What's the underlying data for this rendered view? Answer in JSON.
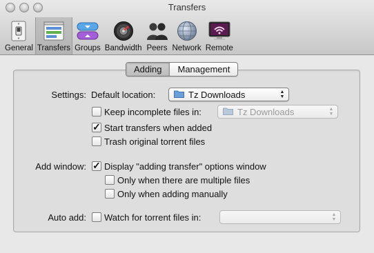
{
  "window": {
    "title": "Transfers"
  },
  "toolbar": {
    "items": [
      {
        "label": "General",
        "icon": "light-switch-icon",
        "selected": false
      },
      {
        "label": "Transfers",
        "icon": "transfers-window-icon",
        "selected": true
      },
      {
        "label": "Groups",
        "icon": "groups-icon",
        "selected": false
      },
      {
        "label": "Bandwidth",
        "icon": "bandwidth-gauge-icon",
        "selected": false
      },
      {
        "label": "Peers",
        "icon": "peers-icon",
        "selected": false
      },
      {
        "label": "Network",
        "icon": "network-globe-icon",
        "selected": false
      },
      {
        "label": "Remote",
        "icon": "remote-wifi-icon",
        "selected": false
      }
    ]
  },
  "tabs": {
    "adding": "Adding",
    "management": "Management",
    "active": "Adding"
  },
  "settings": {
    "label": "Settings:",
    "default_location_label": "Default location:",
    "default_location_value": "Tz Downloads",
    "keep_incomplete_label": "Keep incomplete files in:",
    "keep_incomplete_checked": false,
    "keep_incomplete_value": "Tz Downloads",
    "start_transfers_label": "Start transfers when added",
    "start_transfers_checked": true,
    "trash_original_label": "Trash original torrent files",
    "trash_original_checked": false
  },
  "add_window": {
    "label": "Add window:",
    "display_options_label": "Display \"adding transfer\" options window",
    "display_options_checked": true,
    "multiple_files_label": "Only when there are multiple files",
    "multiple_files_checked": false,
    "adding_manually_label": "Only when adding manually",
    "adding_manually_checked": false
  },
  "auto_add": {
    "label": "Auto add:",
    "watch_label": "Watch for torrent files in:",
    "watch_checked": false,
    "watch_value": ""
  },
  "colors": {
    "window_bg": "#e8e8e8",
    "panel_bg": "#dedede",
    "folder_blue": "#6a9fd8"
  }
}
